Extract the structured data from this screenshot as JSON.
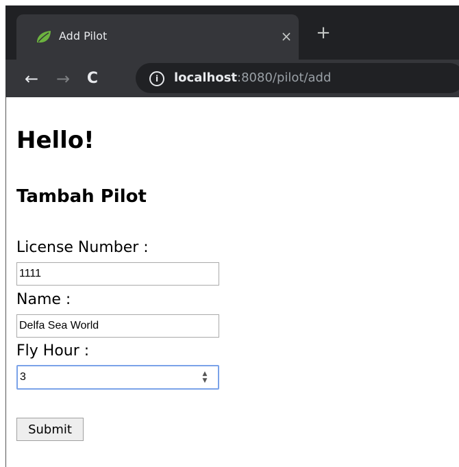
{
  "browser": {
    "tab": {
      "title": "Add Pilot",
      "close_glyph": "×"
    },
    "new_tab_glyph": "+",
    "nav": {
      "back_glyph": "←",
      "forward_glyph": "→",
      "reload_glyph": "C"
    },
    "address": {
      "info_glyph": "i",
      "host": "localhost",
      "rest": ":8080/pilot/add"
    },
    "icons": {
      "favicon": "spring-leaf-icon",
      "info": "info-icon",
      "back": "arrow-left-icon",
      "forward": "arrow-right-icon",
      "reload": "reload-icon",
      "close": "close-icon",
      "new_tab": "plus-icon"
    },
    "colors": {
      "chrome_bg": "#202124",
      "tab_bg": "#35363a",
      "favicon": "#6cb33f"
    }
  },
  "page": {
    "greeting": "Hello!",
    "heading": "Tambah Pilot",
    "form": {
      "license_label": "License Number :",
      "license_value": "1111",
      "name_label": "Name :",
      "name_value": "Delfa Sea World",
      "fly_hour_label": "Fly Hour :",
      "fly_hour_value": "3",
      "submit_label": "Submit"
    }
  }
}
